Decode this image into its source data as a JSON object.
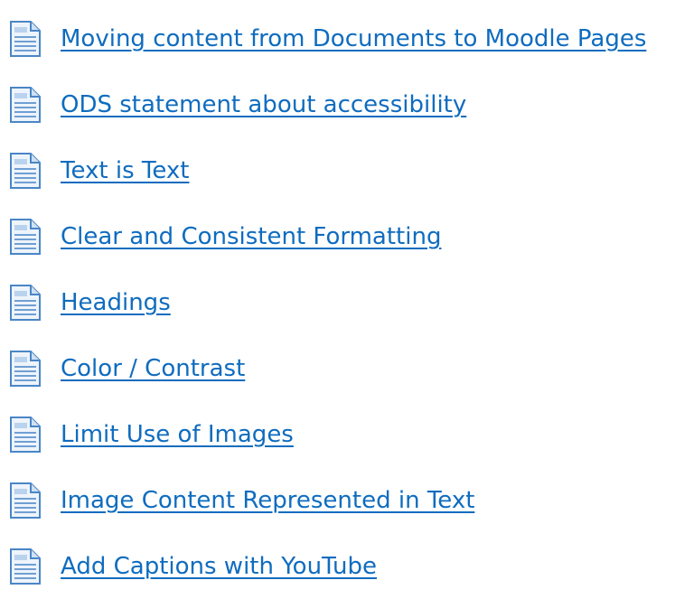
{
  "activities": {
    "items": [
      {
        "label": "Moving content from Documents to Moodle Pages",
        "icon": "page-icon"
      },
      {
        "label": "ODS statement about accessibility",
        "icon": "page-icon"
      },
      {
        "label": "Text is Text",
        "icon": "page-icon"
      },
      {
        "label": "Clear and Consistent Formatting",
        "icon": "page-icon"
      },
      {
        "label": "Headings",
        "icon": "page-icon"
      },
      {
        "label": "Color / Contrast",
        "icon": "page-icon"
      },
      {
        "label": "Limit Use of Images",
        "icon": "page-icon"
      },
      {
        "label": "Image Content Represented in Text",
        "icon": "page-icon"
      },
      {
        "label": "Add Captions with YouTube",
        "icon": "page-icon"
      }
    ]
  },
  "colors": {
    "link": "#0f6cbf",
    "icon_fill": "#dbe9f8",
    "icon_stroke": "#4a86c6"
  }
}
